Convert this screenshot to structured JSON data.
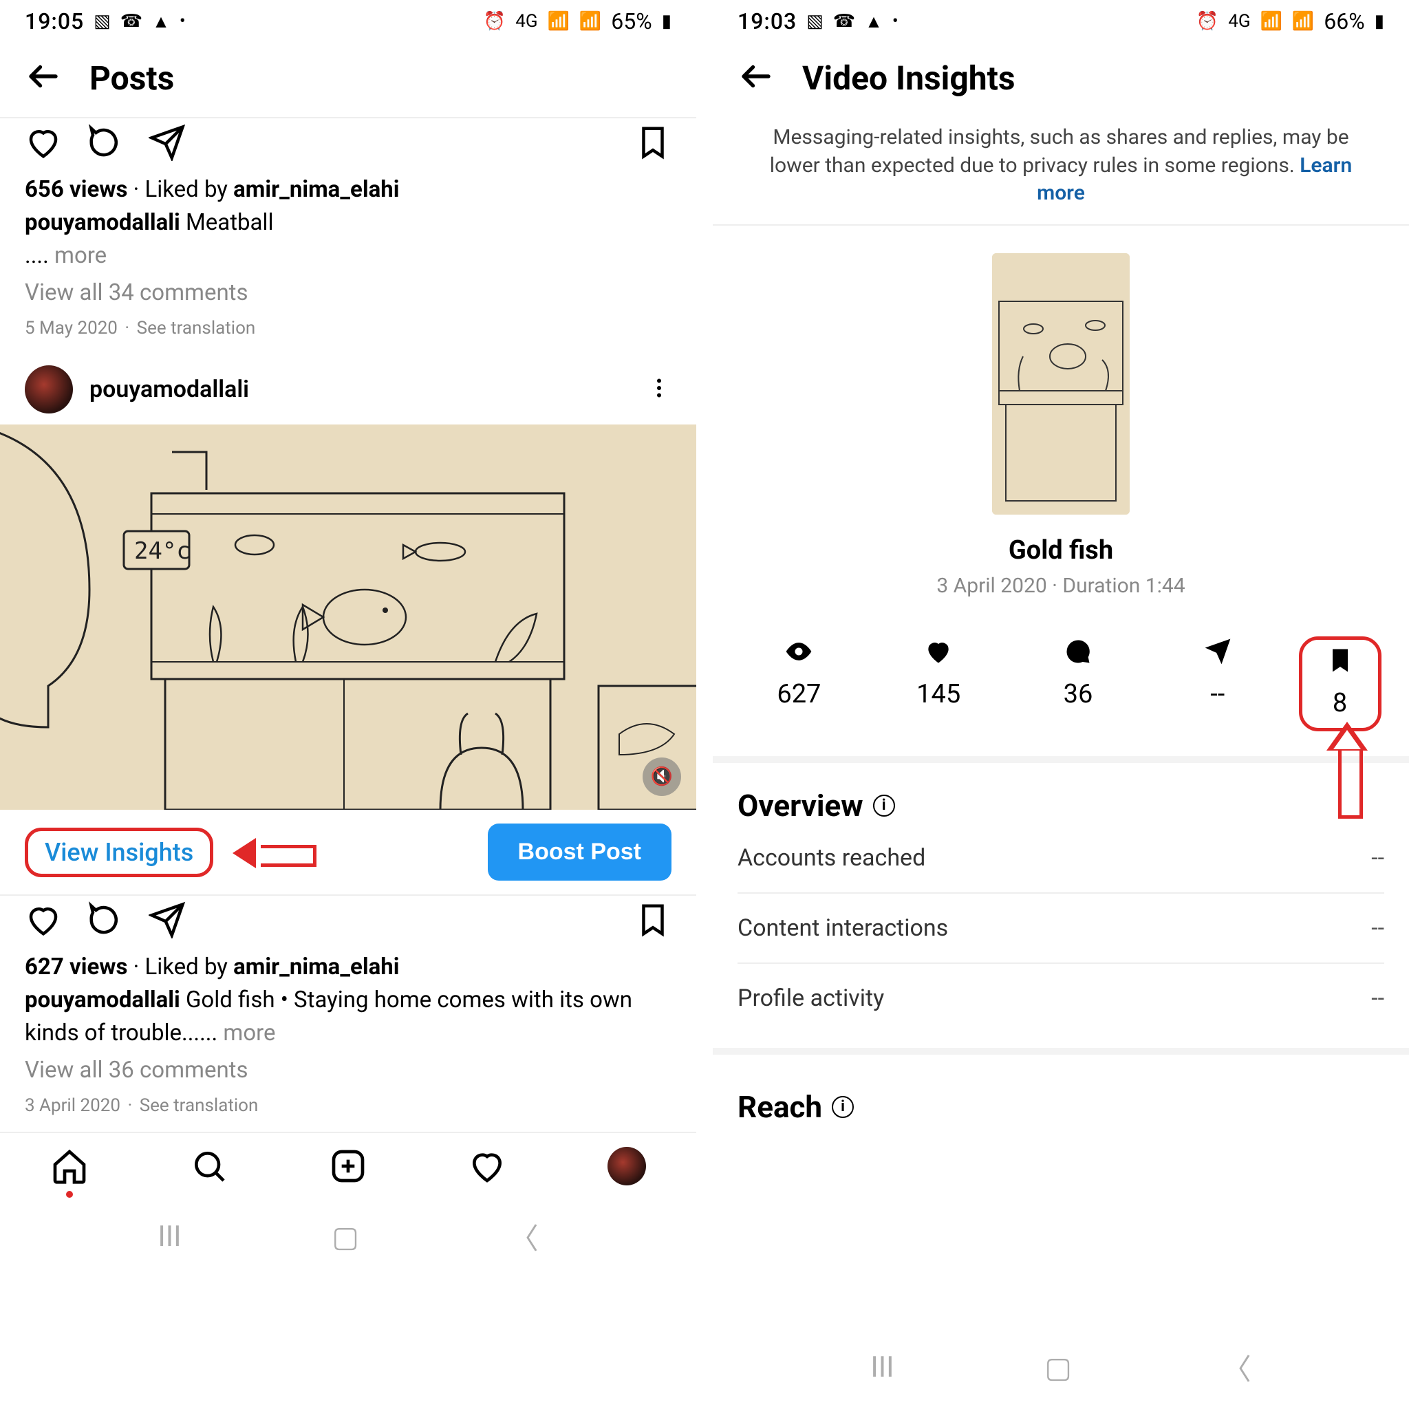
{
  "left": {
    "status": {
      "time": "19:05",
      "battery": "65%",
      "net": "4G"
    },
    "header": {
      "title": "Posts"
    },
    "post1": {
      "views": "656 views",
      "liked_by_prefix": "Liked by",
      "liked_by_user": "amir_nima_elahi",
      "caption_user": "pouyamodallali",
      "caption_text": "Meatball",
      "ellipsis": "....",
      "more": "more",
      "view_comments": "View all 34 comments",
      "date": "5 May 2020",
      "see_translation": "See translation"
    },
    "posthead": {
      "username": "pouyamodallali"
    },
    "media": {
      "temp": "24°c"
    },
    "under": {
      "view_insights": "View Insights",
      "boost": "Boost Post"
    },
    "post2": {
      "views": "627 views",
      "liked_by_prefix": "Liked by",
      "liked_by_user": "amir_nima_elahi",
      "caption_user": "pouyamodallali",
      "caption_text": "Gold fish • Staying home comes with its own kinds of trouble......",
      "more": "more",
      "view_comments": "View all 36 comments",
      "date": "3 April 2020",
      "see_translation": "See translation"
    }
  },
  "right": {
    "status": {
      "time": "19:03",
      "battery": "66%",
      "net": "4G"
    },
    "header": {
      "title": "Video Insights"
    },
    "notice": {
      "text": "Messaging-related insights, such as shares and replies, may be lower than expected due to privacy rules in some regions. ",
      "link": "Learn more"
    },
    "video": {
      "title": "Gold fish",
      "meta": "3 April 2020 · Duration 1:44"
    },
    "stats": {
      "plays": "627",
      "likes": "145",
      "comments": "36",
      "shares": "--",
      "saves": "8"
    },
    "overview": {
      "title": "Overview",
      "rows": [
        {
          "label": "Accounts reached",
          "value": "--"
        },
        {
          "label": "Content interactions",
          "value": "--"
        },
        {
          "label": "Profile activity",
          "value": "--"
        }
      ]
    },
    "reach": {
      "title": "Reach"
    }
  }
}
